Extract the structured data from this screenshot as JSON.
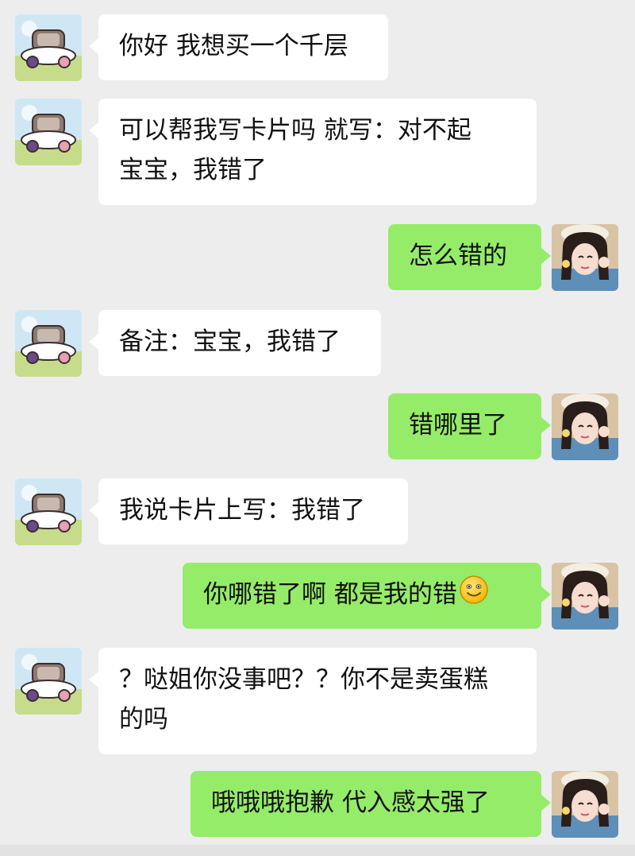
{
  "colors": {
    "background": "#ededed",
    "incoming_bubble": "#ffffff",
    "outgoing_bubble": "#95ec69",
    "text": "#111111"
  },
  "avatars": {
    "contact": "cartoon-car-avatar",
    "self": "girl-selfie-avatar"
  },
  "messages": [
    {
      "side": "in",
      "text": "你好 我想买一个千层"
    },
    {
      "side": "in",
      "text": "可以帮我写卡片吗 就写：对不起\n宝宝，我错了"
    },
    {
      "side": "out",
      "text": "怎么错的"
    },
    {
      "side": "in",
      "text": "备注：宝宝，我错了"
    },
    {
      "side": "out",
      "text": "错哪里了"
    },
    {
      "side": "in",
      "text": "我说卡片上写：我错了"
    },
    {
      "side": "out",
      "text": "你哪错了啊 都是我的错",
      "emoji": "smile-emoji"
    },
    {
      "side": "in",
      "text": "？哒姐你没事吧？？你不是卖蛋糕\n的吗"
    },
    {
      "side": "out",
      "text": "哦哦哦抱歉 代入感太强了"
    }
  ]
}
